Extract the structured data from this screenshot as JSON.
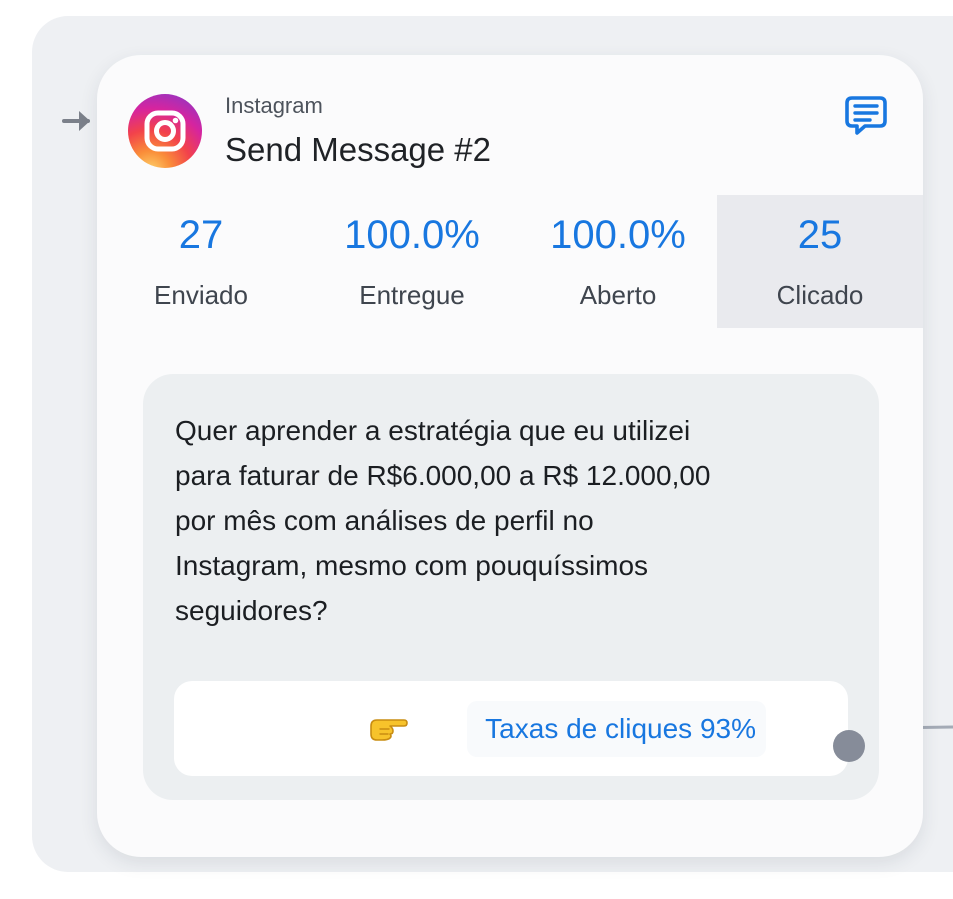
{
  "node": {
    "source": "Instagram",
    "title": "Send Message #2",
    "icons": {
      "logo": "instagram-icon",
      "comment": "comment-icon",
      "entry": "arrow-right-icon",
      "emoji": "pointing-hand-icon"
    }
  },
  "stats": [
    {
      "value": "27",
      "label": "Enviado",
      "active": false
    },
    {
      "value": "100.0%",
      "label": "Entregue",
      "active": false
    },
    {
      "value": "100.0%",
      "label": "Aberto",
      "active": false
    },
    {
      "value": "25",
      "label": "Clicado",
      "active": true
    }
  ],
  "message": {
    "lines": [
      "Quer aprender a estratégia que eu utilizei",
      "para faturar de R$6.000,00 a R$ 12.000,00",
      "por mês com análises de perfil no",
      "Instagram, mesmo com pouquíssimos",
      "seguidores?"
    ],
    "button_label": "Taxas de cliques 93%"
  },
  "colors": {
    "accent": "#1877e0",
    "canvas": "#eef0f3",
    "card": "#fbfbfc",
    "connector": "#868c99"
  }
}
